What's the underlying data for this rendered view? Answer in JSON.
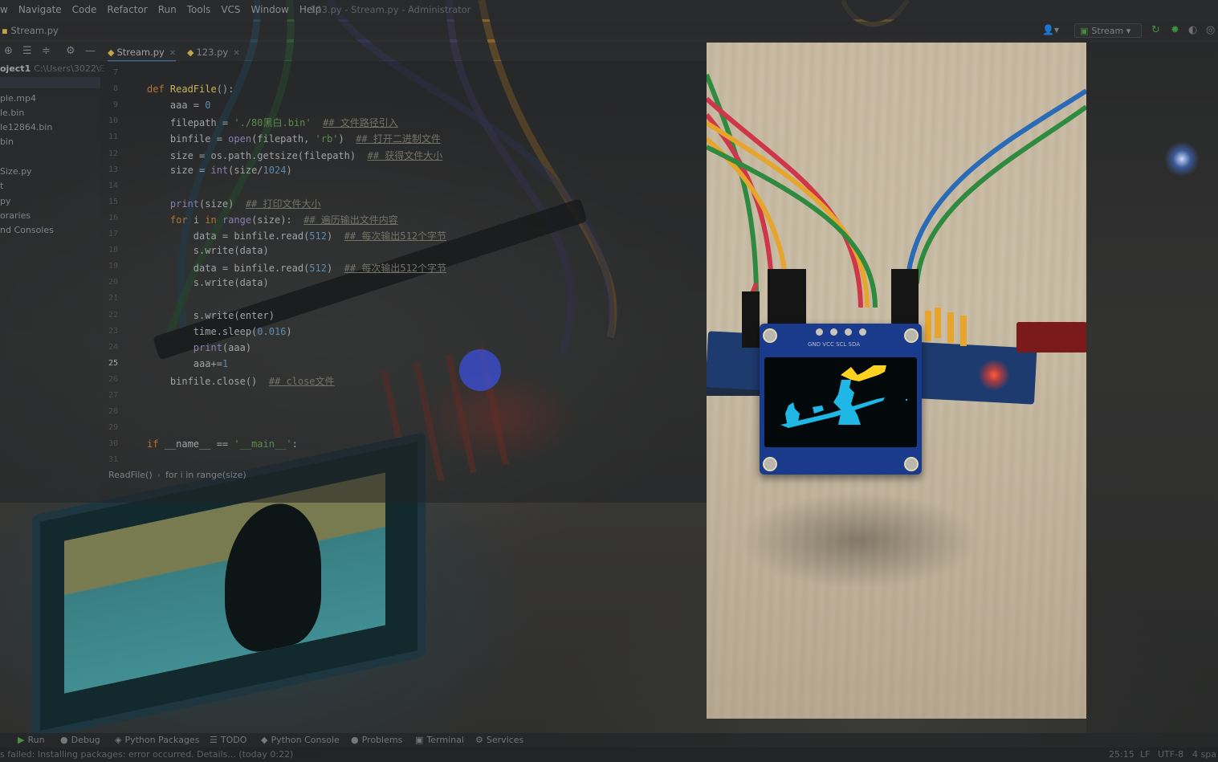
{
  "window": {
    "title": "123.py - Stream.py - Administrator"
  },
  "menu": {
    "items": [
      "w",
      "Navigate",
      "Code",
      "Refactor",
      "Run",
      "Tools",
      "VCS",
      "Window",
      "Help"
    ]
  },
  "navbar": {
    "breadcrumb": "Stream.py",
    "run_config": "Stream"
  },
  "tabs": [
    {
      "label": "Stream.py",
      "active": true
    },
    {
      "label": "123.py",
      "active": false
    }
  ],
  "project": {
    "root_label": "oject1",
    "root_path": "C:\\Users\\3022\\E",
    "items": [
      "ple.mp4",
      "le.bin",
      "le12864.bin",
      "bin",
      "",
      "Size.py",
      "t",
      "py",
      "oraries",
      "nd Consoles"
    ]
  },
  "editor": {
    "line_numbers": [
      "7",
      "8",
      "9",
      "10",
      "11",
      "12",
      "13",
      "14",
      "15",
      "16",
      "17",
      "18",
      "19",
      "20",
      "21",
      "22",
      "23",
      "24",
      "25",
      "26",
      "27",
      "28",
      "29",
      "30",
      "31"
    ],
    "current_line": "25",
    "lines": [
      {
        "num": "7",
        "segs": [
          {
            "t": "        "
          }
        ]
      },
      {
        "num": "8",
        "segs": [
          {
            "t": "def ",
            "c": "kw"
          },
          {
            "t": "ReadFile",
            "c": "fn"
          },
          {
            "t": "():"
          }
        ]
      },
      {
        "num": "9",
        "segs": [
          {
            "t": "    aaa = "
          },
          {
            "t": "0",
            "c": "num"
          }
        ]
      },
      {
        "num": "10",
        "segs": [
          {
            "t": "    filepath = "
          },
          {
            "t": "'./80黑白.bin'",
            "c": "str"
          },
          {
            "t": "  "
          },
          {
            "t": "## 文件路径引入",
            "c": "cmt"
          }
        ]
      },
      {
        "num": "11",
        "segs": [
          {
            "t": "    binfile = "
          },
          {
            "t": "open",
            "c": "builtin"
          },
          {
            "t": "(filepath, "
          },
          {
            "t": "'rb'",
            "c": "str"
          },
          {
            "t": ")  "
          },
          {
            "t": "## 打开二进制文件",
            "c": "cmt"
          }
        ]
      },
      {
        "num": "12",
        "segs": [
          {
            "t": "    size = os.path.getsize(filepath)  "
          },
          {
            "t": "## 获得文件大小",
            "c": "cmt"
          }
        ]
      },
      {
        "num": "13",
        "segs": [
          {
            "t": "    size = "
          },
          {
            "t": "int",
            "c": "builtin"
          },
          {
            "t": "(size/"
          },
          {
            "t": "1024",
            "c": "num"
          },
          {
            "t": ")"
          }
        ]
      },
      {
        "num": "14",
        "segs": [
          {
            "t": ""
          }
        ]
      },
      {
        "num": "15",
        "segs": [
          {
            "t": "    "
          },
          {
            "t": "print",
            "c": "builtin"
          },
          {
            "t": "(size)  "
          },
          {
            "t": "## 打印文件大小",
            "c": "cmt"
          }
        ]
      },
      {
        "num": "16",
        "segs": [
          {
            "t": "    "
          },
          {
            "t": "for ",
            "c": "kw"
          },
          {
            "t": "i "
          },
          {
            "t": "in ",
            "c": "kw"
          },
          {
            "t": "range",
            "c": "builtin"
          },
          {
            "t": "(size):  "
          },
          {
            "t": "## 遍历输出文件内容",
            "c": "cmt"
          }
        ]
      },
      {
        "num": "17",
        "segs": [
          {
            "t": "        data = binfile.read("
          },
          {
            "t": "512",
            "c": "num"
          },
          {
            "t": ")  "
          },
          {
            "t": "## 每次输出512个字节",
            "c": "cmt"
          }
        ]
      },
      {
        "num": "18",
        "segs": [
          {
            "t": "        s.write(data)"
          }
        ]
      },
      {
        "num": "19",
        "segs": [
          {
            "t": "        data = binfile.read("
          },
          {
            "t": "512",
            "c": "num"
          },
          {
            "t": ")  "
          },
          {
            "t": "## 每次输出512个字节",
            "c": "cmt"
          }
        ]
      },
      {
        "num": "20",
        "segs": [
          {
            "t": "        s.write(data)"
          }
        ]
      },
      {
        "num": "21",
        "segs": [
          {
            "t": ""
          }
        ]
      },
      {
        "num": "22",
        "segs": [
          {
            "t": "        s.write(enter)"
          }
        ]
      },
      {
        "num": "23",
        "segs": [
          {
            "t": "        time.sleep("
          },
          {
            "t": "0.016",
            "c": "num"
          },
          {
            "t": ")"
          }
        ]
      },
      {
        "num": "24",
        "segs": [
          {
            "t": "        "
          },
          {
            "t": "print",
            "c": "builtin"
          },
          {
            "t": "(aaa)"
          }
        ]
      },
      {
        "num": "25",
        "segs": [
          {
            "t": "        aaa+="
          },
          {
            "t": "1",
            "c": "num"
          }
        ]
      },
      {
        "num": "26",
        "segs": [
          {
            "t": "    binfile.close()  "
          },
          {
            "t": "## close文件",
            "c": "cmt"
          }
        ]
      },
      {
        "num": "27",
        "segs": [
          {
            "t": ""
          }
        ]
      },
      {
        "num": "28",
        "segs": [
          {
            "t": ""
          }
        ]
      },
      {
        "num": "29",
        "segs": [
          {
            "t": ""
          }
        ]
      },
      {
        "num": "30",
        "segs": [
          {
            "t": "if ",
            "c": "kw"
          },
          {
            "t": "__name__ == "
          },
          {
            "t": "'__main__'",
            "c": "str"
          },
          {
            "t": ":"
          }
        ]
      },
      {
        "num": "31",
        "segs": [
          {
            "t": ""
          }
        ]
      }
    ],
    "crumb": [
      "ReadFile()",
      "for i in range(size)"
    ]
  },
  "bottom_tools": [
    "Run",
    "Debug",
    "Python Packages",
    "TODO",
    "Python Console",
    "Problems",
    "Terminal",
    "Services"
  ],
  "status": {
    "message": "s failed: Installing packages: error occurred. Details... (today 0:22)",
    "position": "25:15",
    "line_sep": "LF",
    "encoding": "UTF-8",
    "indent": "4 spa"
  },
  "video": {
    "oled_label": "GND VCC SCL SDA"
  },
  "colors": {
    "keyword": "#b57436",
    "function": "#c9b35a",
    "string": "#5f8a4e",
    "comment": "#757268",
    "oled_cyan": "#1fb8e6",
    "oled_yellow": "#ffd21f"
  }
}
